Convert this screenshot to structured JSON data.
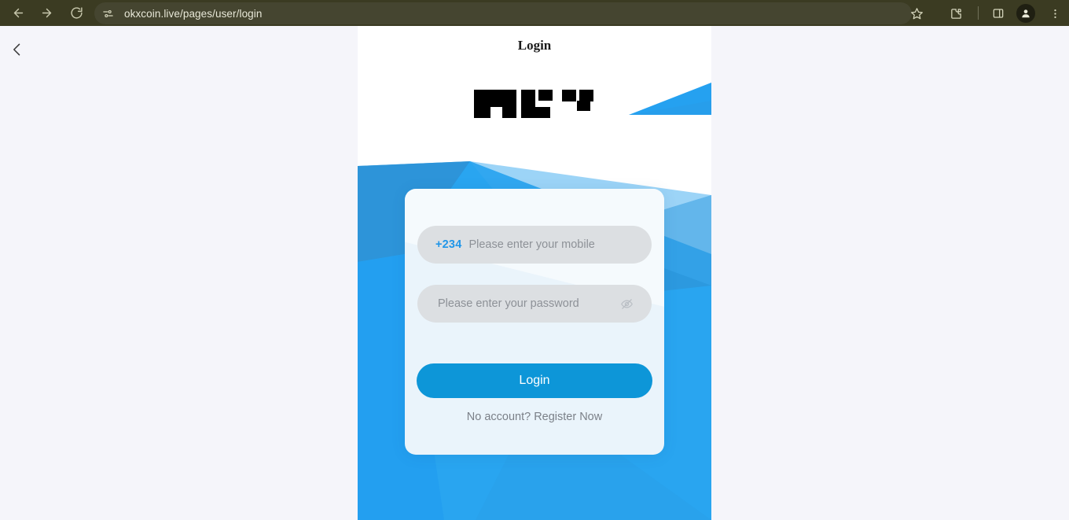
{
  "browser": {
    "url": "okxcoin.live/pages/user/login",
    "back_label": "Back",
    "forward_label": "Forward",
    "reload_label": "Reload",
    "site_info_label": "View site information",
    "bookmark_label": "Bookmark this tab",
    "extensions_label": "Extensions",
    "side_panel_label": "Side panel",
    "profile_label": "Profile",
    "menu_label": "Customize and control Chrome",
    "toolbar_bg": "#3b3b22",
    "omnibox_bg": "#454530",
    "omnibox_text_color": "#e8e8d8"
  },
  "page": {
    "title": "Login",
    "back_chevron_label": "Go back",
    "logo_label": "brand-logo-redacted",
    "background_color": "#f5f5fa",
    "frame_background": "#ffffff",
    "accent_blue": "#29a5f0",
    "accent_blue_dark": "#2f8fd1",
    "card_background": "#eaf4fb"
  },
  "form": {
    "country_code": "+234",
    "mobile_value": "",
    "mobile_placeholder": "Please enter your mobile",
    "password_value": "",
    "password_placeholder": "Please enter your password",
    "password_toggle_label": "eye-off-icon",
    "login_button_label": "Login",
    "login_button_color": "#0d96d8",
    "register_text": "No account? Register Now",
    "register_text_color": "#7b8088",
    "country_code_color": "#2196e8",
    "field_background": "#dcdfe2",
    "placeholder_color": "#8d9197"
  }
}
